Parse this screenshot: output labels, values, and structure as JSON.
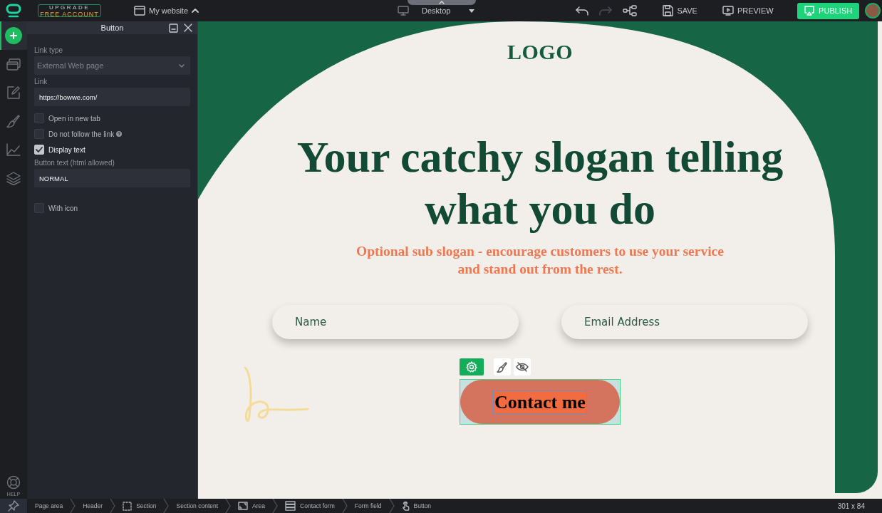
{
  "topbar": {
    "upgrade_top": "UPGRADE",
    "upgrade_bottom": "FREE ACCOUNT",
    "site": "My website",
    "device": "Desktop",
    "save": "SAVE",
    "preview": "PREVIEW",
    "publish": "PUBLISH"
  },
  "rail": {
    "items": [
      {
        "kind": "add",
        "selected": true
      },
      {
        "kind": "pages",
        "selected": false
      },
      {
        "kind": "edit",
        "selected": false
      },
      {
        "kind": "brush",
        "selected": false
      },
      {
        "kind": "chart",
        "selected": false
      },
      {
        "kind": "layers",
        "selected": false
      }
    ],
    "help": "HELP"
  },
  "panel": {
    "title": "Button",
    "fields": [
      {
        "kind": "select",
        "label": "Link type",
        "value": "External Web page"
      },
      {
        "kind": "text",
        "label": "Link",
        "value": "https://bowwe.com/"
      },
      {
        "kind": "checkbox",
        "label": "Open in new tab",
        "checked": false,
        "help": false
      },
      {
        "kind": "checkbox",
        "label": "Do not follow the link",
        "checked": false,
        "help": true
      },
      {
        "kind": "checkbox",
        "label": "Display text",
        "checked": true,
        "help": false
      },
      {
        "kind": "text",
        "label": "Button text (html allowed)",
        "value": "NORMAL"
      },
      {
        "kind": "checkbox",
        "label": "With icon",
        "checked": false,
        "help": false
      }
    ]
  },
  "page": {
    "logo": "LOGO",
    "headline": "Your catchy slogan telling what you do",
    "sub_slogan": "Optional sub slogan - encourage customers to use your service and stand out from the rest.",
    "inputs": [
      {
        "placeholder": "Name"
      },
      {
        "placeholder": "Email Address"
      }
    ],
    "button": "Contact me"
  },
  "breadcrumb": [
    {
      "label": "Page area",
      "kind": "plain"
    },
    {
      "label": "Header",
      "kind": "plain"
    },
    {
      "label": "Section",
      "kind": "section"
    },
    {
      "label": "Section content",
      "kind": "plain"
    },
    {
      "label": "Area",
      "kind": "area"
    },
    {
      "label": "Contact form",
      "kind": "form"
    },
    {
      "label": "Form field",
      "kind": "plain"
    },
    {
      "label": "Button",
      "kind": "button"
    }
  ],
  "size": "301 x 84"
}
